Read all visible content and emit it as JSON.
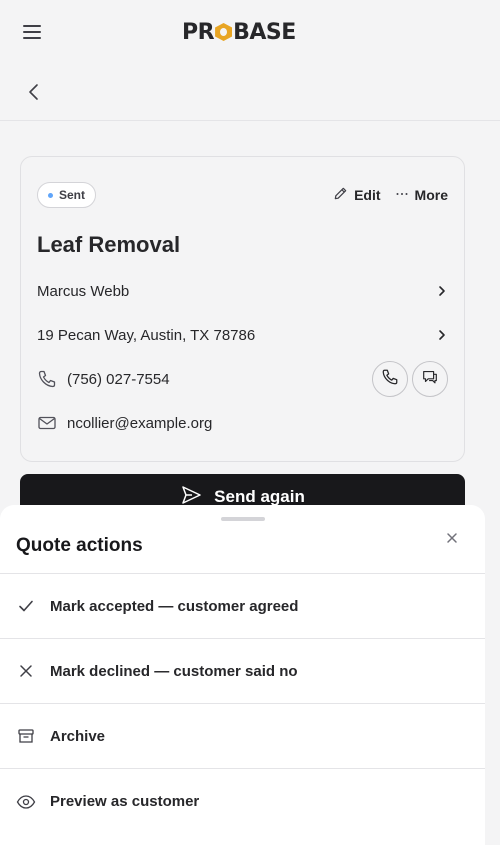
{
  "header": {
    "logo_left": "PR",
    "logo_right": "BASE"
  },
  "quote": {
    "status": "Sent",
    "edit_label": "Edit",
    "more_label": "More",
    "title": "Leaf Removal",
    "customer_name": "Marcus Webb",
    "address": "19 Pecan Way, Austin, TX 78786",
    "phone": "(756) 027-7554",
    "email": "ncollier@example.org",
    "status_color": "#60a5fa"
  },
  "send_button": {
    "label": "Send again"
  },
  "sheet": {
    "title": "Quote actions",
    "actions": [
      {
        "label": "Mark accepted — customer agreed",
        "icon": "check-icon"
      },
      {
        "label": "Mark declined — customer said no",
        "icon": "x-icon"
      },
      {
        "label": "Archive",
        "icon": "archive-icon"
      },
      {
        "label": "Preview as customer",
        "icon": "eye-icon"
      }
    ]
  }
}
